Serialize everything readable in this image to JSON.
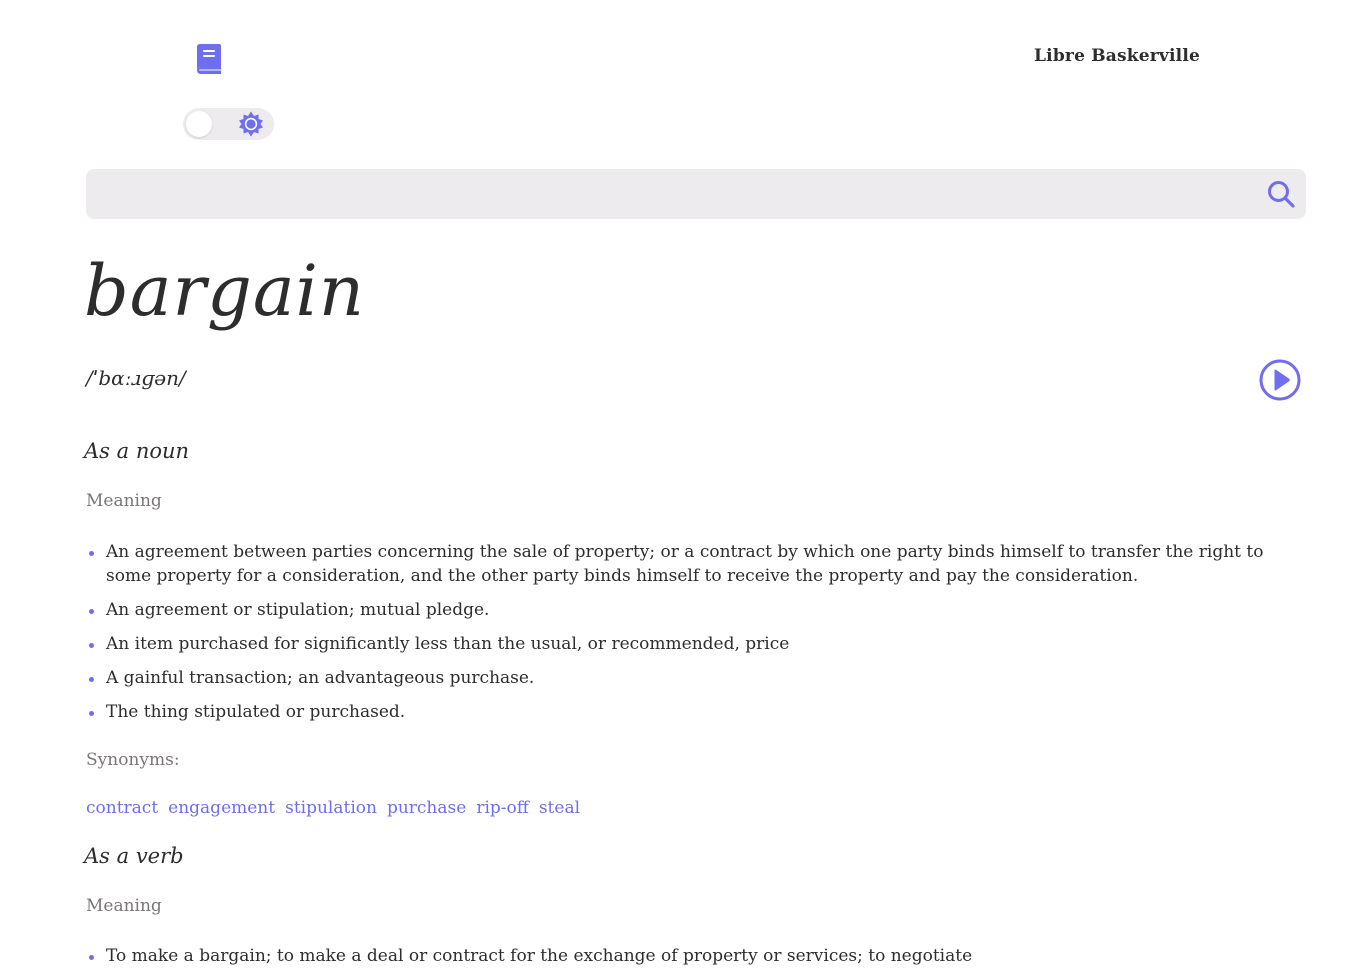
{
  "header": {
    "font_selector_label": "Libre Baskerville"
  },
  "search": {
    "placeholder": "",
    "value": ""
  },
  "entry": {
    "word": "bargain",
    "phonetic": "/ˈbɑːɹɡən/",
    "sections": [
      {
        "part_of_speech": "As a noun",
        "meaning_label": "Meaning",
        "definitions": [
          "An agreement between parties concerning the sale of property; or a contract by which one party binds himself to transfer the right to some property for a consideration, and the other party binds himself to receive the property and pay the consideration.",
          "An agreement or stipulation; mutual pledge.",
          "An item purchased for significantly less than the usual, or recommended, price",
          "A gainful transaction; an advantageous purchase.",
          "The thing stipulated or purchased."
        ],
        "synonyms_label": "Synonyms:",
        "synonyms": [
          "contract",
          "engagement",
          "stipulation",
          "purchase",
          "rip-off",
          "steal"
        ]
      },
      {
        "part_of_speech": "As a verb",
        "meaning_label": "Meaning",
        "definitions": [
          "To make a bargain; to make a deal or contract for the exchange of property or services; to negotiate"
        ]
      }
    ]
  },
  "icons": {
    "logo": "book-icon",
    "theme": "sun-icon",
    "search": "search-icon",
    "play": "play-icon"
  },
  "colors": {
    "accent": "#6f6ef0",
    "text": "#2d2d2d",
    "muted": "#7a7577",
    "input_bg": "#edebee"
  }
}
